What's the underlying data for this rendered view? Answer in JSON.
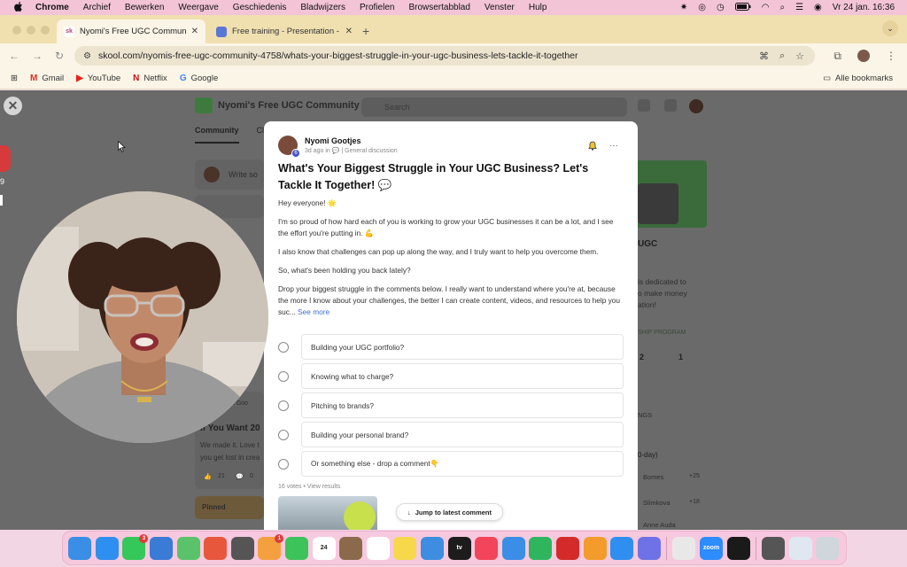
{
  "menubar": {
    "app": "Chrome",
    "items": [
      "Archief",
      "Bewerken",
      "Weergave",
      "Geschiedenis",
      "Bladwijzers",
      "Profielen",
      "Browsertabblad",
      "Venster",
      "Hulp"
    ],
    "datetime": "Vr 24 jan.  16:36"
  },
  "tabs": [
    {
      "title": "Nyomi's Free UGC Communit",
      "favicon": "sk",
      "color": "#b93e7a"
    },
    {
      "title": "Free training - Presentation -",
      "favicon": "",
      "color": "#5b77d6"
    }
  ],
  "omnibox": {
    "url": "skool.com/nyomis-free-ugc-community-4758/whats-your-biggest-struggle-in-your-ugc-business-lets-tackle-it-together"
  },
  "bookmarks": {
    "items": [
      {
        "label": "Gmail",
        "icon": "M",
        "color": "#d93025"
      },
      {
        "label": "YouTube",
        "icon": "▶",
        "color": "#e62117"
      },
      {
        "label": "Netflix",
        "icon": "N",
        "color": "#c11119"
      },
      {
        "label": "Google",
        "icon": "G",
        "color": "#4285f4"
      }
    ],
    "all": "Alle bookmarks"
  },
  "background": {
    "community_name": "Nyomi's Free UGC Community",
    "tab_community": "Community",
    "tab_classroom": "Cla",
    "search_placeholder": "Search",
    "write": "Write so",
    "post_title": "If You Want 20",
    "post_author": "yomi Goo",
    "post_excerpt1": "We made it. Love t",
    "post_excerpt2": "you get lost in crea",
    "likes": "21",
    "comments": "0",
    "pinned": "Pinned",
    "side_ugc": "UGC",
    "side_dedicated": "is dedicated to",
    "side_money": "o make money",
    "side_ation": "ation!",
    "side_program": "SHIP PROGRAM",
    "stat1": "2",
    "stat2": "1",
    "leader1": "Bomes",
    "leader2": "Slimkova",
    "leader3": "Anne Auda",
    "leader_pts1": "+25",
    "leader_pts2": "+18",
    "ngs": "NGS",
    "period": "0-day)",
    "side_num": "9"
  },
  "post": {
    "author": "Nyomi Gootjes",
    "level": "6",
    "meta": "3d ago in 💬 | General discussion",
    "title": "What's Your Biggest Struggle in Your UGC Business? Let's Tackle It Together! 💬",
    "paragraphs": [
      "Hey everyone! 🌟",
      "I'm so proud of how hard each of you is working to grow your UGC businesses it can be a lot, and I see the effort you're putting in. 💪",
      "I also know that challenges can pop up along the way, and I truly want to help you overcome them.",
      "So, what's been holding you back lately?"
    ],
    "last_paragraph": "Drop your biggest struggle in the comments below. I really want to understand where you're at, because the more I know about your challenges, the better I can create content, videos, and resources to help you suc...",
    "see_more": "See more",
    "poll_options": [
      "Building your UGC portfolio?",
      "Knowing what to charge?",
      "Pitching to brands?",
      "Building your personal brand?",
      "Or something else - drop a comment👇"
    ],
    "votes": "16 votes • View results",
    "jump_label": "Jump to latest comment"
  },
  "dock": {
    "icons": [
      {
        "name": "finder",
        "color": "#3a8ee6"
      },
      {
        "name": "safari",
        "color": "#2f8ff0"
      },
      {
        "name": "messages",
        "color": "#34c759",
        "badge": "3"
      },
      {
        "name": "mail",
        "color": "#3a7bd5"
      },
      {
        "name": "maps",
        "color": "#5ac26a"
      },
      {
        "name": "launchpad",
        "color": "#e7573b"
      },
      {
        "name": "chatgpt",
        "color": "#555555"
      },
      {
        "name": "photos",
        "color": "#f4a040",
        "badge": "1"
      },
      {
        "name": "facetime",
        "color": "#3cc35a"
      },
      {
        "name": "calendar",
        "color": "#ffffff",
        "label": "24"
      },
      {
        "name": "keynote-brown",
        "color": "#8b6a4b"
      },
      {
        "name": "reminders",
        "color": "#ffffff"
      },
      {
        "name": "notes",
        "color": "#f7d84b"
      },
      {
        "name": "freeform",
        "color": "#3e8de0"
      },
      {
        "name": "apple-tv",
        "color": "#1c1c1c",
        "label": "tv"
      },
      {
        "name": "music",
        "color": "#f2445a"
      },
      {
        "name": "keynote",
        "color": "#3a8ee6"
      },
      {
        "name": "numbers",
        "color": "#2fb55e"
      },
      {
        "name": "acrobat",
        "color": "#d42a2a"
      },
      {
        "name": "pages",
        "color": "#f39b2b"
      },
      {
        "name": "app-store",
        "color": "#2f8ff0"
      },
      {
        "name": "system-settings",
        "color": "#6f72e6"
      },
      {
        "name": "chrome",
        "color": "#e8e8e8"
      },
      {
        "name": "zoom",
        "color": "#2d8cff",
        "label": "zoom"
      },
      {
        "name": "capcut",
        "color": "#1a1a1a"
      },
      {
        "name": "photo-doc",
        "color": "#555555"
      },
      {
        "name": "preview",
        "color": "#dfe8f1"
      },
      {
        "name": "trash",
        "color": "#cfd6dc"
      }
    ]
  }
}
